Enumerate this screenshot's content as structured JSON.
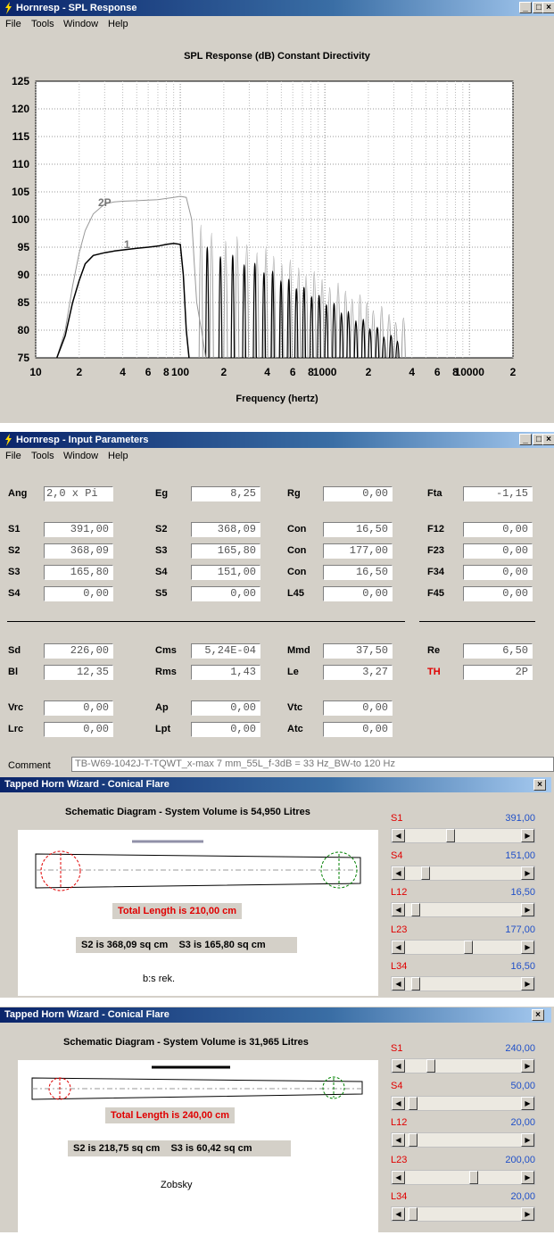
{
  "spl_window": {
    "title": "Hornresp - SPL Response",
    "menu": [
      "File",
      "Tools",
      "Window",
      "Help"
    ],
    "chart_title": "SPL Response (dB)    Constant Directivity",
    "x_label": "Frequency (hertz)",
    "y_ticks": [
      "125",
      "120",
      "115",
      "110",
      "105",
      "100",
      "95",
      "90",
      "85",
      "80",
      "75"
    ],
    "x_ticks": [
      "10",
      "2",
      "4",
      "6",
      "8",
      "100",
      "2",
      "4",
      "6",
      "8",
      "1000",
      "2",
      "4",
      "6",
      "8",
      "10000",
      "2"
    ],
    "curve_labels": [
      "2P",
      "1"
    ]
  },
  "chart_data": {
    "type": "line",
    "title": "SPL Response (dB)    Constant Directivity",
    "xlabel": "Frequency (hertz)",
    "ylabel": "",
    "x_scale": "log",
    "xlim": [
      10,
      20000
    ],
    "ylim": [
      75,
      125
    ],
    "grid": true,
    "series": [
      {
        "name": "2P",
        "x": [
          14,
          16,
          18,
          20,
          22,
          25,
          30,
          35,
          40,
          50,
          60,
          70,
          80,
          90,
          100,
          110,
          120,
          125,
          130,
          140,
          150
        ],
        "y": [
          75,
          80,
          88,
          94,
          98,
          101,
          102.8,
          103.2,
          103.3,
          103.4,
          103.5,
          103.6,
          103.8,
          104,
          104.2,
          104,
          100,
          92,
          85,
          80,
          75
        ]
      },
      {
        "name": "1",
        "x": [
          14,
          16,
          18,
          20,
          22,
          25,
          30,
          35,
          40,
          50,
          60,
          70,
          80,
          90,
          100,
          105,
          110,
          115
        ],
        "y": [
          75,
          79,
          85,
          89,
          92,
          93.5,
          94,
          94.3,
          94.5,
          94.8,
          95,
          95.2,
          95.5,
          95.7,
          95.5,
          90,
          80,
          75
        ]
      }
    ]
  },
  "input_window": {
    "title": "Hornresp - Input Parameters",
    "menu": [
      "File",
      "Tools",
      "Window",
      "Help"
    ],
    "rows": [
      [
        {
          "l": "Ang",
          "v": "2,0 x Pi"
        },
        {
          "l": "Eg",
          "v": "8,25"
        },
        {
          "l": "Rg",
          "v": "0,00"
        },
        {
          "l": "Fta",
          "v": "-1,15"
        }
      ],
      [
        {
          "l": "S1",
          "v": "391,00"
        },
        {
          "l": "S2",
          "v": "368,09"
        },
        {
          "l": "Con",
          "v": "16,50"
        },
        {
          "l": "F12",
          "v": "0,00"
        }
      ],
      [
        {
          "l": "S2",
          "v": "368,09"
        },
        {
          "l": "S3",
          "v": "165,80"
        },
        {
          "l": "Con",
          "v": "177,00"
        },
        {
          "l": "F23",
          "v": "0,00"
        }
      ],
      [
        {
          "l": "S3",
          "v": "165,80"
        },
        {
          "l": "S4",
          "v": "151,00"
        },
        {
          "l": "Con",
          "v": "16,50"
        },
        {
          "l": "F34",
          "v": "0,00"
        }
      ],
      [
        {
          "l": "S4",
          "v": "0,00"
        },
        {
          "l": "S5",
          "v": "0,00"
        },
        {
          "l": "L45",
          "v": "0,00"
        },
        {
          "l": "F45",
          "v": "0,00"
        }
      ],
      [
        {
          "l": "Sd",
          "v": "226,00"
        },
        {
          "l": "Cms",
          "v": "5,24E-04"
        },
        {
          "l": "Mmd",
          "v": "37,50"
        },
        {
          "l": "Re",
          "v": "6,50"
        }
      ],
      [
        {
          "l": "Bl",
          "v": "12,35"
        },
        {
          "l": "Rms",
          "v": "1,43"
        },
        {
          "l": "Le",
          "v": "3,27"
        },
        {
          "l": "TH",
          "v": "2P"
        }
      ],
      [
        {
          "l": "Vrc",
          "v": "0,00"
        },
        {
          "l": "Ap",
          "v": "0,00"
        },
        {
          "l": "Vtc",
          "v": "0,00"
        }
      ],
      [
        {
          "l": "Lrc",
          "v": "0,00"
        },
        {
          "l": "Lpt",
          "v": "0,00"
        },
        {
          "l": "Atc",
          "v": "0,00"
        }
      ]
    ],
    "comment_label": "Comment",
    "comment_value": "TB-W69-1042J-T-TQWT_x-max 7 mm_55L_f-3dB = 33 Hz_BW-to 120 Hz"
  },
  "wizard1": {
    "title": "Tapped Horn Wizard - Conical Flare",
    "diagram_title": "Schematic Diagram - System Volume is 54,950 Litres",
    "total_length": "Total Length is 210,00 cm",
    "s2": "S2 is 368,09 sq cm",
    "s3": "S3 is 165,80 sq cm",
    "note": "b:s rek.",
    "sliders": [
      {
        "l": "S1",
        "v": "391,00",
        "pos": 0.38
      },
      {
        "l": "S4",
        "v": "151,00",
        "pos": 0.15
      },
      {
        "l": "L12",
        "v": "16,50",
        "pos": 0.06
      },
      {
        "l": "L23",
        "v": "177,00",
        "pos": 0.55
      },
      {
        "l": "L34",
        "v": "16,50",
        "pos": 0.06
      }
    ]
  },
  "wizard2": {
    "title": "Tapped Horn Wizard - Conical Flare",
    "diagram_title": "Schematic Diagram - System Volume is 31,965 Litres",
    "total_length": "Total Length is 240,00 cm",
    "s2": "S2 is 218,75 sq cm",
    "s3": "S3 is 60,42 sq cm",
    "note": "Zobsky",
    "sliders": [
      {
        "l": "S1",
        "v": "240,00",
        "pos": 0.2
      },
      {
        "l": "S4",
        "v": "50,00",
        "pos": 0.03
      },
      {
        "l": "L12",
        "v": "20,00",
        "pos": 0.03
      },
      {
        "l": "L23",
        "v": "200,00",
        "pos": 0.6
      },
      {
        "l": "L34",
        "v": "20,00",
        "pos": 0.03
      }
    ]
  }
}
